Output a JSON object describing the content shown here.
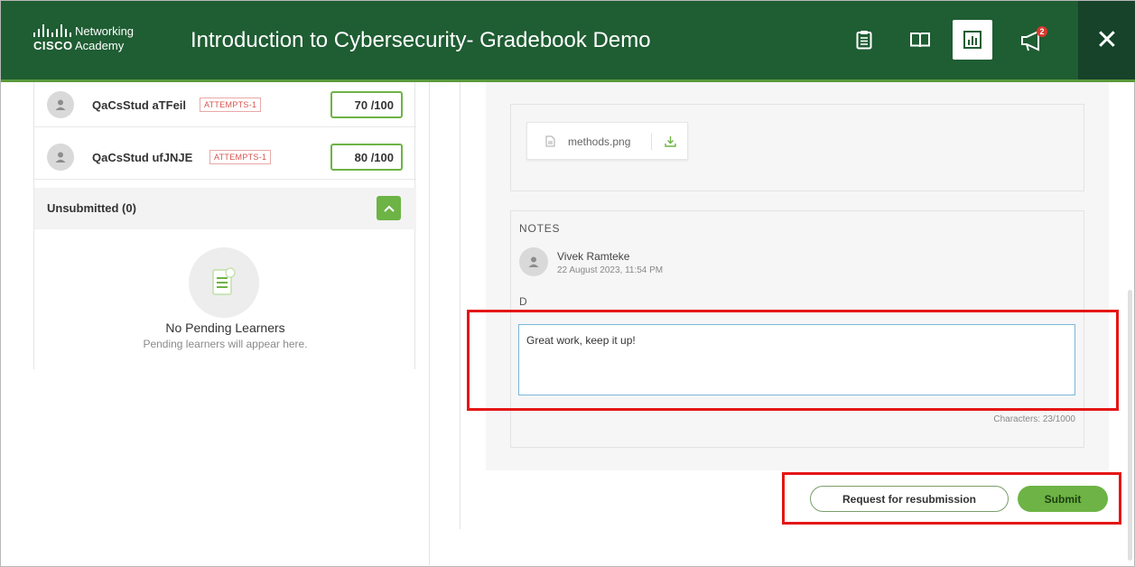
{
  "header": {
    "logo_line1": "Networking",
    "logo_line2": "Academy",
    "logo_word": "cisco",
    "title": "Introduction to Cybersecurity- Gradebook Demo",
    "icons": [
      "clipboard-icon",
      "book-icon",
      "chart-icon",
      "megaphone-icon",
      "close-icon"
    ],
    "notification_count": "2",
    "close_glyph": "✕"
  },
  "learners": [
    {
      "name": "QaCsStud aTFeil",
      "attempts": "ATTEMPTS-1",
      "score": "70 /100"
    },
    {
      "name": "QaCsStud ufJNJE",
      "attempts": "ATTEMPTS-1",
      "score": "80 /100"
    }
  ],
  "unsubmitted": {
    "label": "Unsubmitted (0)",
    "empty_title": "No Pending Learners",
    "empty_subtitle": "Pending learners will appear here."
  },
  "attachment": {
    "file_name": "methods.png"
  },
  "notes": {
    "heading": "NOTES",
    "author": "Vivek Ramteke",
    "timestamp": "22 August 2023, 11:54 PM",
    "text": "D",
    "input_value": "Great work, keep it up!",
    "char_count": "Characters: 23/1000"
  },
  "actions": {
    "resubmit_label": "Request for resubmission",
    "submit_label": "Submit"
  },
  "colors": {
    "header_bg": "#1f5d33",
    "accent_green": "#6db345",
    "highlight_red": "#e51616"
  }
}
